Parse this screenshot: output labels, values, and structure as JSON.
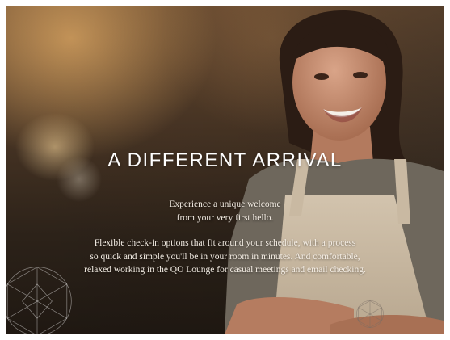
{
  "hero": {
    "headline": "A DIFFERENT ARRIVAL",
    "intro_lines": [
      "Experience a unique welcome",
      "from your very first hello."
    ],
    "body_lines": [
      "Flexible check-in options that fit around your schedule, with a process",
      "so quick and simple you'll be in your room in minutes. And comfortable,",
      "relaxed working in the QO Lounge for casual meetings and email checking."
    ]
  },
  "colors": {
    "text": "#ffffff",
    "apron": "#c8b8a1",
    "shirt": "#6e675c"
  },
  "icons": [
    "geometric-pattern-icon",
    "geometric-pattern-icon"
  ]
}
